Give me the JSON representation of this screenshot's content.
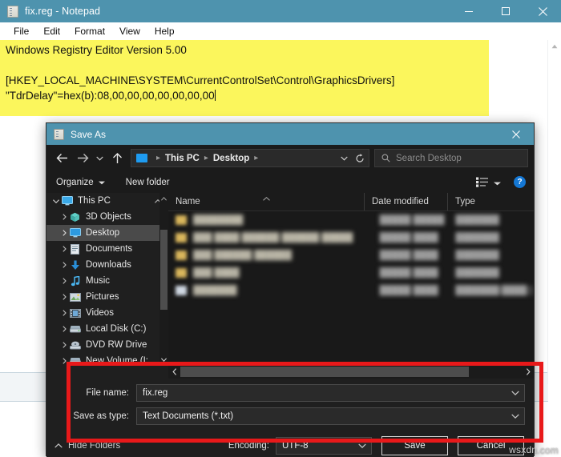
{
  "notepad": {
    "title": "fix.reg - Notepad",
    "icon": "notepad-icon",
    "window_controls": {
      "minimize": "minimize-icon",
      "maximize": "maximize-icon",
      "close": "close-icon"
    },
    "menu": [
      "File",
      "Edit",
      "Format",
      "View",
      "Help"
    ],
    "document_text": "Windows Registry Editor Version 5.00\n\n[HKEY_LOCAL_MACHINE\\SYSTEM\\CurrentControlSet\\Control\\GraphicsDrivers]\n\"TdrDelay\"=hex(b):08,00,00,00,00,00,00,00",
    "highlight_color": "#fbf65c"
  },
  "dialog": {
    "title": "Save As",
    "icon": "notepad-icon",
    "close_label": "close-icon",
    "nav": {
      "back": "back-arrow-icon",
      "forward": "forward-arrow-icon",
      "recent": "chevron-down-icon",
      "up": "up-arrow-icon",
      "breadcrumb": [
        "This PC",
        "Desktop"
      ],
      "refresh": "refresh-icon",
      "search_placeholder": "Search Desktop",
      "search_icon": "search-icon"
    },
    "toolbar": {
      "organize": "Organize",
      "new_folder": "New folder",
      "view_icon": "view-options-icon",
      "help": "?"
    },
    "tree": [
      {
        "label": "This PC",
        "icon": "monitor-icon",
        "expanded": true,
        "indent": 0,
        "selected": false
      },
      {
        "label": "3D Objects",
        "icon": "cube-icon",
        "expanded": false,
        "indent": 1,
        "selected": false
      },
      {
        "label": "Desktop",
        "icon": "desktop-icon",
        "expanded": false,
        "indent": 1,
        "selected": true
      },
      {
        "label": "Documents",
        "icon": "documents-icon",
        "expanded": false,
        "indent": 1,
        "selected": false
      },
      {
        "label": "Downloads",
        "icon": "download-icon",
        "expanded": false,
        "indent": 1,
        "selected": false
      },
      {
        "label": "Music",
        "icon": "music-icon",
        "expanded": false,
        "indent": 1,
        "selected": false
      },
      {
        "label": "Pictures",
        "icon": "pictures-icon",
        "expanded": false,
        "indent": 1,
        "selected": false
      },
      {
        "label": "Videos",
        "icon": "videos-icon",
        "expanded": false,
        "indent": 1,
        "selected": false
      },
      {
        "label": "Local Disk (C:)",
        "icon": "drive-icon",
        "expanded": false,
        "indent": 1,
        "selected": false
      },
      {
        "label": "DVD RW Drive",
        "icon": "disc-icon",
        "expanded": false,
        "indent": 1,
        "selected": false
      },
      {
        "label": "New Volume (I:",
        "icon": "drive-icon",
        "expanded": false,
        "indent": 1,
        "selected": false
      }
    ],
    "columns": [
      "Name",
      "Date modified",
      "Type"
    ],
    "sort_indicator": "sort-ascending-icon",
    "files": [
      {
        "name": "████████",
        "date": "█████ █████",
        "type": "███████",
        "icon": "folder-icon"
      },
      {
        "name": "███ ████ ██████ ██████ █████",
        "date": "█████ ████",
        "type": "███████",
        "icon": "folder-icon"
      },
      {
        "name": "███ ██████ ██████",
        "date": "█████ ████",
        "type": "███████",
        "icon": "folder-icon"
      },
      {
        "name": "███ ████",
        "date": "█████ ████",
        "type": "███████",
        "icon": "folder-icon"
      },
      {
        "name": "███████",
        "date": "█████ ████",
        "type": "███████ ████",
        "icon": "document-icon"
      }
    ],
    "file_name": {
      "label": "File name:",
      "value": "fix.reg",
      "dropdown": "chevron-down-icon"
    },
    "save_as_type": {
      "label": "Save as type:",
      "value": "Text Documents (*.txt)",
      "dropdown": "chevron-down-icon"
    },
    "hide_folders": {
      "label": "Hide Folders",
      "icon": "chevron-up-icon"
    },
    "encoding": {
      "label": "Encoding:",
      "value": "UTF-8",
      "dropdown": "chevron-down-icon"
    },
    "save_button": "Save",
    "cancel_button": "Cancel"
  },
  "annotation": {
    "color": "#e8191a",
    "name": "highlight-rectangle"
  },
  "watermark": "wsxdn.com"
}
